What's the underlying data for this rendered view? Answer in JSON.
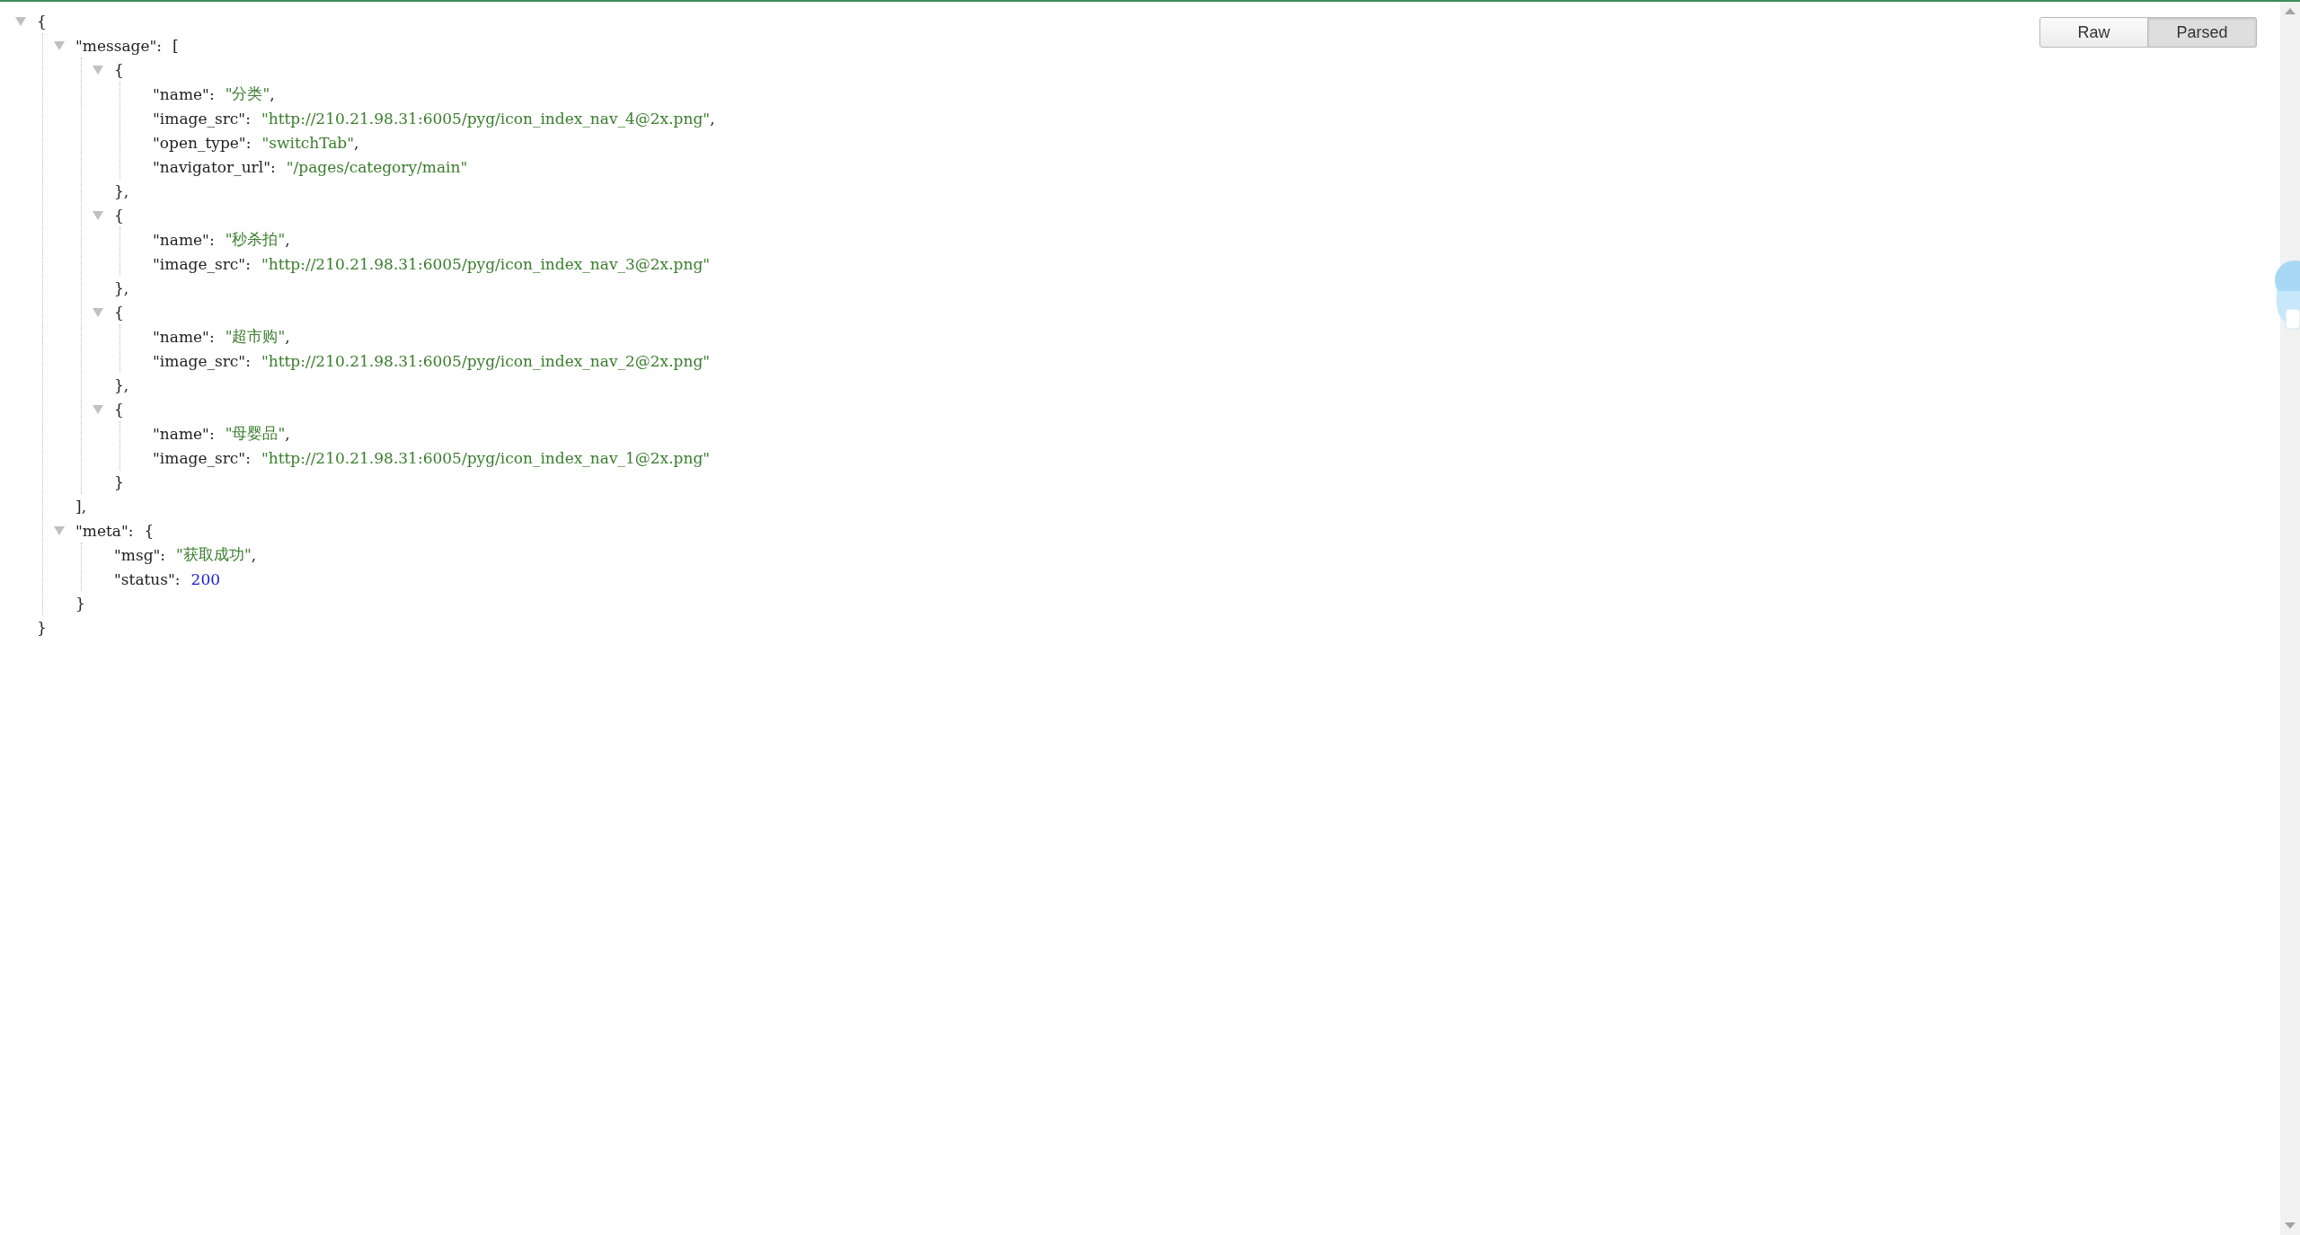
{
  "view_buttons": [
    {
      "label": "Raw",
      "selected": false
    },
    {
      "label": "Parsed",
      "selected": true
    }
  ],
  "tree": {
    "open": "{",
    "expanded": true,
    "close": "}",
    "children": [
      {
        "key": "\"message\":",
        "open": "[",
        "expanded": true,
        "close": "],",
        "children": [
          {
            "open": "{",
            "expanded": true,
            "close": "},",
            "children": [
              {
                "key": "\"name\":",
                "value": "\"分类\"",
                "kind": "string",
                "comma": ","
              },
              {
                "key": "\"image_src\":",
                "value": "\"http://210.21.98.31:6005/pyg/icon_index_nav_4@2x.png\"",
                "kind": "string",
                "comma": ","
              },
              {
                "key": "\"open_type\":",
                "value": "\"switchTab\"",
                "kind": "string",
                "comma": ","
              },
              {
                "key": "\"navigator_url\":",
                "value": "\"/pages/category/main\"",
                "kind": "string"
              }
            ]
          },
          {
            "open": "{",
            "expanded": true,
            "close": "},",
            "children": [
              {
                "key": "\"name\":",
                "value": "\"秒杀拍\"",
                "kind": "string",
                "comma": ","
              },
              {
                "key": "\"image_src\":",
                "value": "\"http://210.21.98.31:6005/pyg/icon_index_nav_3@2x.png\"",
                "kind": "string"
              }
            ]
          },
          {
            "open": "{",
            "expanded": true,
            "close": "},",
            "children": [
              {
                "key": "\"name\":",
                "value": "\"超市购\"",
                "kind": "string",
                "comma": ","
              },
              {
                "key": "\"image_src\":",
                "value": "\"http://210.21.98.31:6005/pyg/icon_index_nav_2@2x.png\"",
                "kind": "string"
              }
            ]
          },
          {
            "open": "{",
            "expanded": true,
            "close": "}",
            "children": [
              {
                "key": "\"name\":",
                "value": "\"母婴品\"",
                "kind": "string",
                "comma": ","
              },
              {
                "key": "\"image_src\":",
                "value": "\"http://210.21.98.31:6005/pyg/icon_index_nav_1@2x.png\"",
                "kind": "string"
              }
            ]
          }
        ]
      },
      {
        "key": "\"meta\":",
        "open": "{",
        "expanded": true,
        "close": "}",
        "children": [
          {
            "key": "\"msg\":",
            "value": "\"获取成功\"",
            "kind": "string",
            "comma": ","
          },
          {
            "key": "\"status\":",
            "value": "200",
            "kind": "number"
          }
        ]
      }
    ]
  }
}
